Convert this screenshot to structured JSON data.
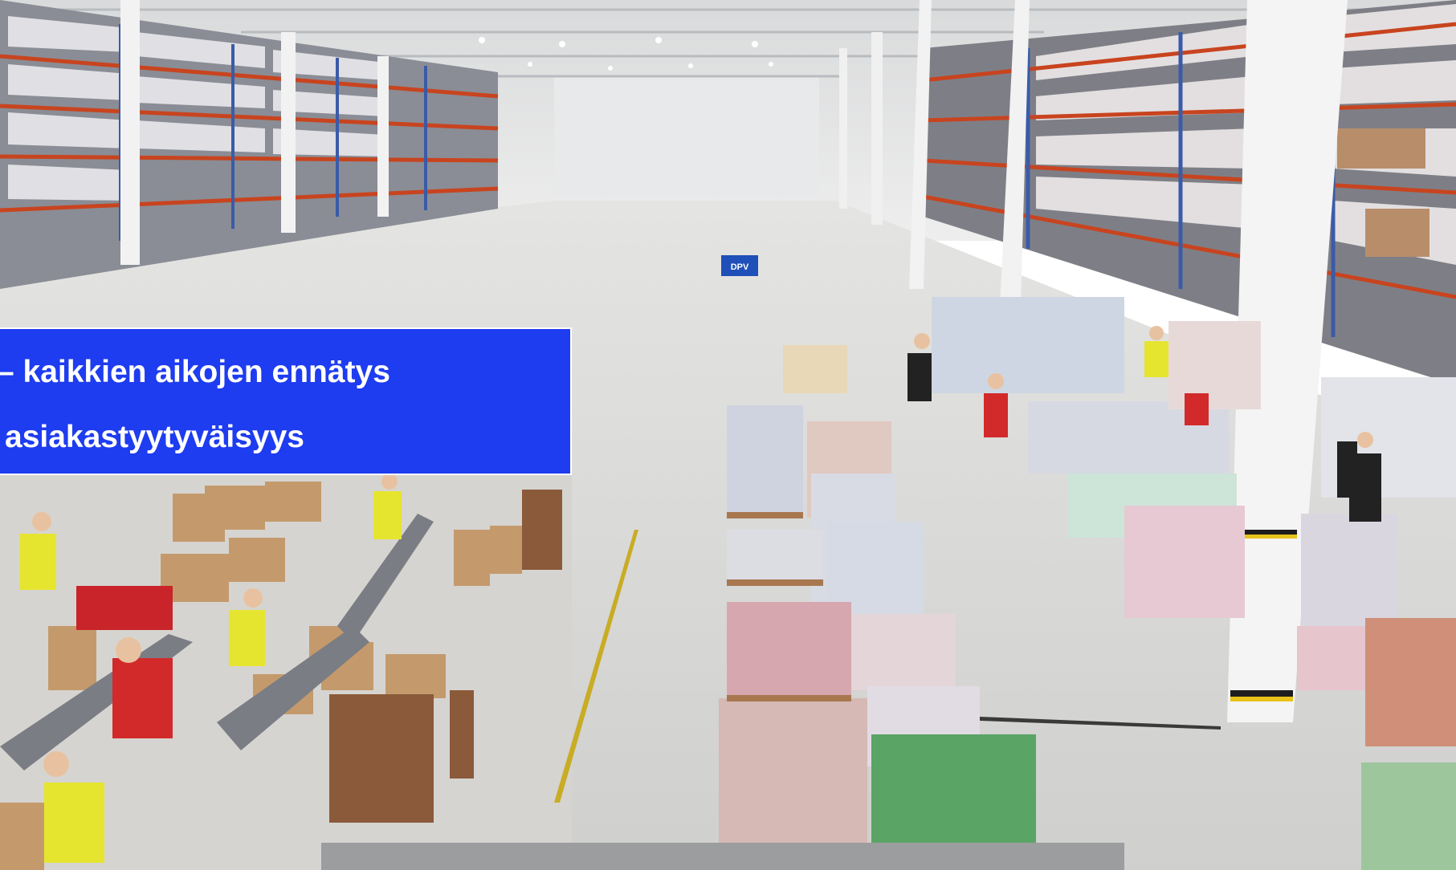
{
  "caption": {
    "line1": "– kaikkien aikojen ennätys",
    "line2": "asiakastyytyväisyys"
  },
  "photo": {
    "sign_text": "DPV"
  },
  "colors": {
    "caption_background": "#1e3cf0",
    "caption_text": "#ffffff"
  }
}
